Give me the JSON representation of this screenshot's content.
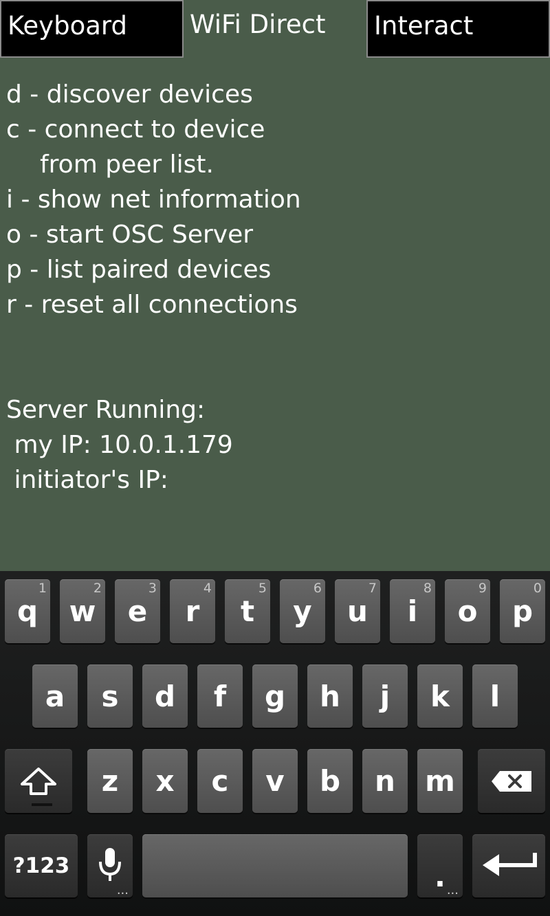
{
  "tabs": [
    {
      "label": "Keyboard",
      "selected": false
    },
    {
      "label": "WiFi Direct",
      "selected": true
    },
    {
      "label": "Interact",
      "selected": false
    }
  ],
  "commands": [
    "d - discover devices",
    "c - connect to device",
    "from peer list.",
    "i - show net information",
    "o - start OSC Server",
    "p - list paired devices",
    "r - reset all connections"
  ],
  "status": {
    "title": "Server Running:",
    "my_ip": " my IP: 10.0.1.179",
    "initiator_ip": " initiator's IP:"
  },
  "keyboard": {
    "row1": [
      {
        "label": "q",
        "hint": "1"
      },
      {
        "label": "w",
        "hint": "2"
      },
      {
        "label": "e",
        "hint": "3"
      },
      {
        "label": "r",
        "hint": "4"
      },
      {
        "label": "t",
        "hint": "5"
      },
      {
        "label": "y",
        "hint": "6"
      },
      {
        "label": "u",
        "hint": "7"
      },
      {
        "label": "i",
        "hint": "8"
      },
      {
        "label": "o",
        "hint": "9"
      },
      {
        "label": "p",
        "hint": "0"
      }
    ],
    "row2": [
      "a",
      "s",
      "d",
      "f",
      "g",
      "h",
      "j",
      "k",
      "l"
    ],
    "row3": [
      "z",
      "x",
      "c",
      "v",
      "b",
      "n",
      "m"
    ],
    "symbols_label": "?123",
    "period_label": ".",
    "more_dots": "..."
  },
  "colors": {
    "background": "#4a5c4a",
    "tab_inactive": "#000000",
    "key": "#5a5a5a",
    "keyboard_bg": "#161717"
  },
  "icons": {
    "shift": "shift-arrow-icon",
    "backspace": "backspace-icon",
    "mic": "microphone-icon",
    "enter": "enter-arrow-icon"
  }
}
